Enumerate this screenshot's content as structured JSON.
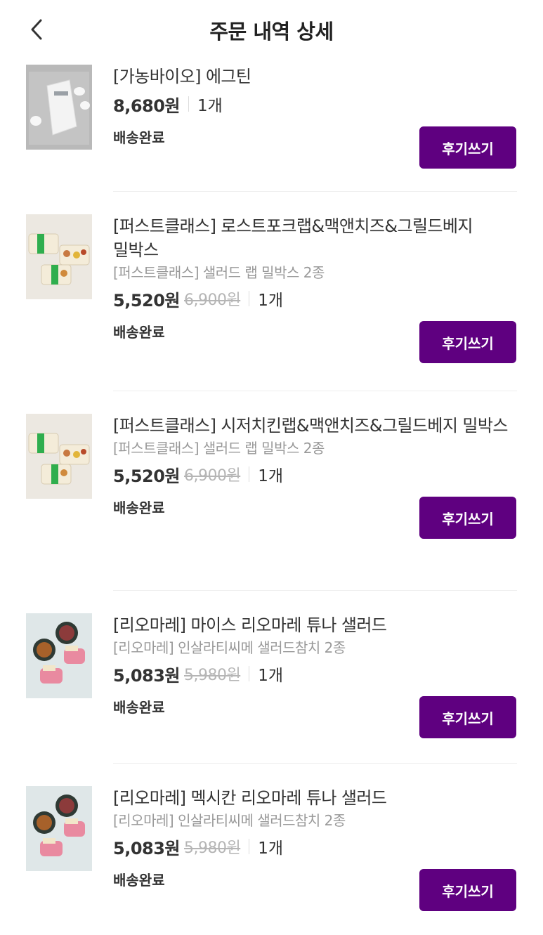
{
  "header": {
    "title": "주문 내역 상세",
    "back_icon": "chevron-left-icon"
  },
  "colors": {
    "accent": "#5f0080",
    "muted": "#999999",
    "strike": "#b5b5b5"
  },
  "items": [
    {
      "name": "[가농바이오] 에그틴",
      "option": "",
      "price": "8,680원",
      "original_price": "",
      "quantity": "1개",
      "status": "배송완료",
      "review_label": "후기쓰기",
      "thumb": "egg-pack"
    },
    {
      "name": "[퍼스트클래스] 로스트포크랩&맥앤치즈&그릴드베지 밀박스",
      "option": "[퍼스트클래스] 샐러드 랩 밀박스 2종",
      "price": "5,520원",
      "original_price": "6,900원",
      "quantity": "1개",
      "status": "배송완료",
      "review_label": "후기쓰기",
      "thumb": "mealbox"
    },
    {
      "name": "[퍼스트클래스] 시저치킨랩&맥앤치즈&그릴드베지 밀박스",
      "option": "[퍼스트클래스] 샐러드 랩 밀박스 2종",
      "price": "5,520원",
      "original_price": "6,900원",
      "quantity": "1개",
      "status": "배송완료",
      "review_label": "후기쓰기",
      "thumb": "mealbox"
    },
    {
      "name": "[리오마레] 마이스 리오마레 튜나 샐러드",
      "option": "[리오마레] 인살라티씨메 샐러드참치 2종",
      "price": "5,083원",
      "original_price": "5,980원",
      "quantity": "1개",
      "status": "배송완료",
      "review_label": "후기쓰기",
      "thumb": "tuna"
    },
    {
      "name": "[리오마레] 멕시칸 리오마레 튜나 샐러드",
      "option": "[리오마레] 인살라티씨메 샐러드참치 2종",
      "price": "5,083원",
      "original_price": "5,980원",
      "quantity": "1개",
      "status": "배송완료",
      "review_label": "후기쓰기",
      "thumb": "tuna"
    }
  ]
}
